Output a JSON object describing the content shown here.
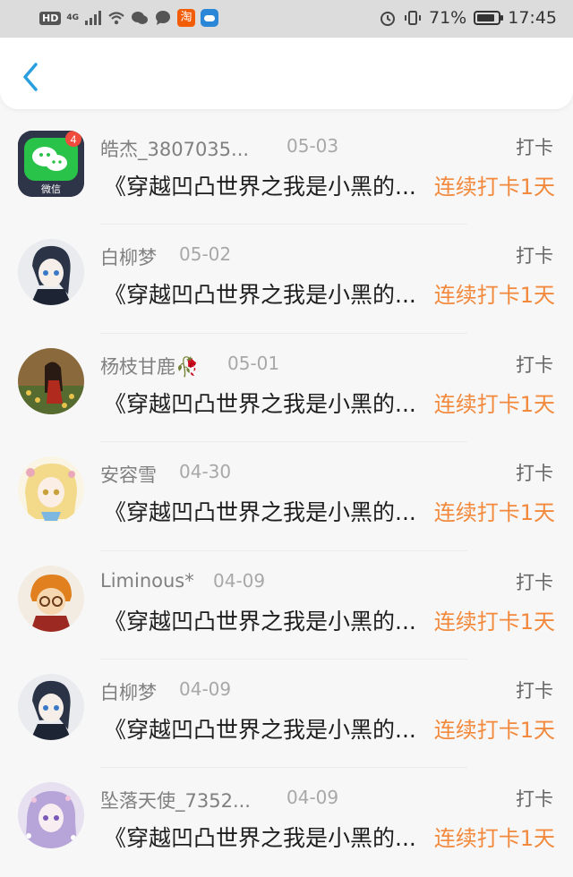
{
  "status": {
    "hd": "HD",
    "net": "4G",
    "battery": "71%",
    "time": "17:45",
    "app_badge": "淘"
  },
  "header": {
    "back_icon": "chevron-left-icon"
  },
  "app_badge_text": "微信",
  "app_badge_count": "4",
  "items": [
    {
      "name": "皓杰_3807035...",
      "date": "05-03",
      "flag": "打卡",
      "title": "《穿越凹凸世界之我是小黑的...",
      "streak": "连续打卡1天"
    },
    {
      "name": "白柳梦",
      "date": "05-02",
      "flag": "打卡",
      "title": "《穿越凹凸世界之我是小黑的...",
      "streak": "连续打卡1天"
    },
    {
      "name": "杨枝甘鹿🥀",
      "date": "05-01",
      "flag": "打卡",
      "title": "《穿越凹凸世界之我是小黑的...",
      "streak": "连续打卡1天"
    },
    {
      "name": "安容雪",
      "date": "04-30",
      "flag": "打卡",
      "title": "《穿越凹凸世界之我是小黑的...",
      "streak": "连续打卡1天"
    },
    {
      "name": "Liminous*",
      "date": "04-09",
      "flag": "打卡",
      "title": "《穿越凹凸世界之我是小黑的...",
      "streak": "连续打卡1天"
    },
    {
      "name": "白柳梦",
      "date": "04-09",
      "flag": "打卡",
      "title": "《穿越凹凸世界之我是小黑的...",
      "streak": "连续打卡1天"
    },
    {
      "name": "坠落天使_7352...",
      "date": "04-09",
      "flag": "打卡",
      "title": "《穿越凹凸世界之我是小黑的...",
      "streak": "连续打卡1天"
    }
  ]
}
